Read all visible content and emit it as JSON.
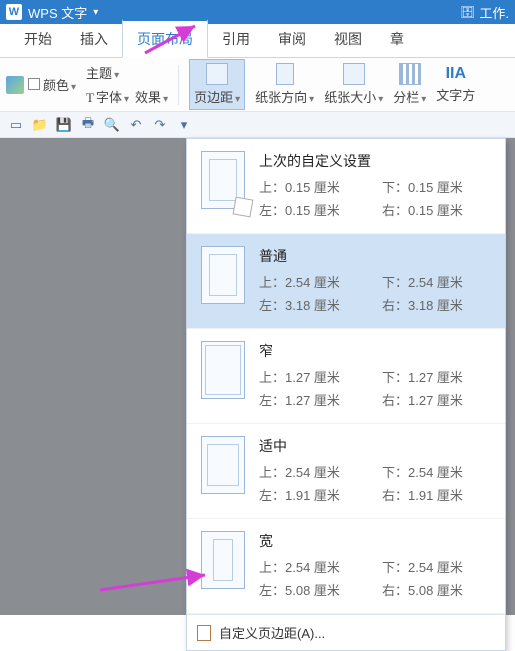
{
  "titlebar": {
    "app": "WPS 文字",
    "work": "工作."
  },
  "tabs": {
    "start": "开始",
    "insert": "插入",
    "layout": "页面布局",
    "ref": "引用",
    "review": "审阅",
    "view": "视图",
    "chapter": "章"
  },
  "ribbon": {
    "color": "颜色",
    "theme": "主题",
    "font": "字体",
    "effect": "效果",
    "margins": "页边距",
    "orientation": "纸张方向",
    "size": "纸张大小",
    "columns": "分栏",
    "textdir": "文字方"
  },
  "presets": [
    {
      "title": "上次的自定义设置",
      "top": "上：0.15 厘米",
      "bottom": "下：0.15 厘米",
      "left": "左：0.15 厘米",
      "right": "右：0.15 厘米"
    },
    {
      "title": "普通",
      "top": "上：2.54 厘米",
      "bottom": "下：2.54 厘米",
      "left": "左：3.18 厘米",
      "right": "右：3.18 厘米"
    },
    {
      "title": "窄",
      "top": "上：1.27 厘米",
      "bottom": "下：1.27 厘米",
      "left": "左：1.27 厘米",
      "right": "右：1.27 厘米"
    },
    {
      "title": "适中",
      "top": "上：2.54 厘米",
      "bottom": "下：2.54 厘米",
      "left": "左：1.91 厘米",
      "right": "右：1.91 厘米"
    },
    {
      "title": "宽",
      "top": "上：2.54 厘米",
      "bottom": "下：2.54 厘米",
      "left": "左：5.08 厘米",
      "right": "右：5.08 厘米"
    }
  ],
  "custom": "自定义页边距(A)..."
}
